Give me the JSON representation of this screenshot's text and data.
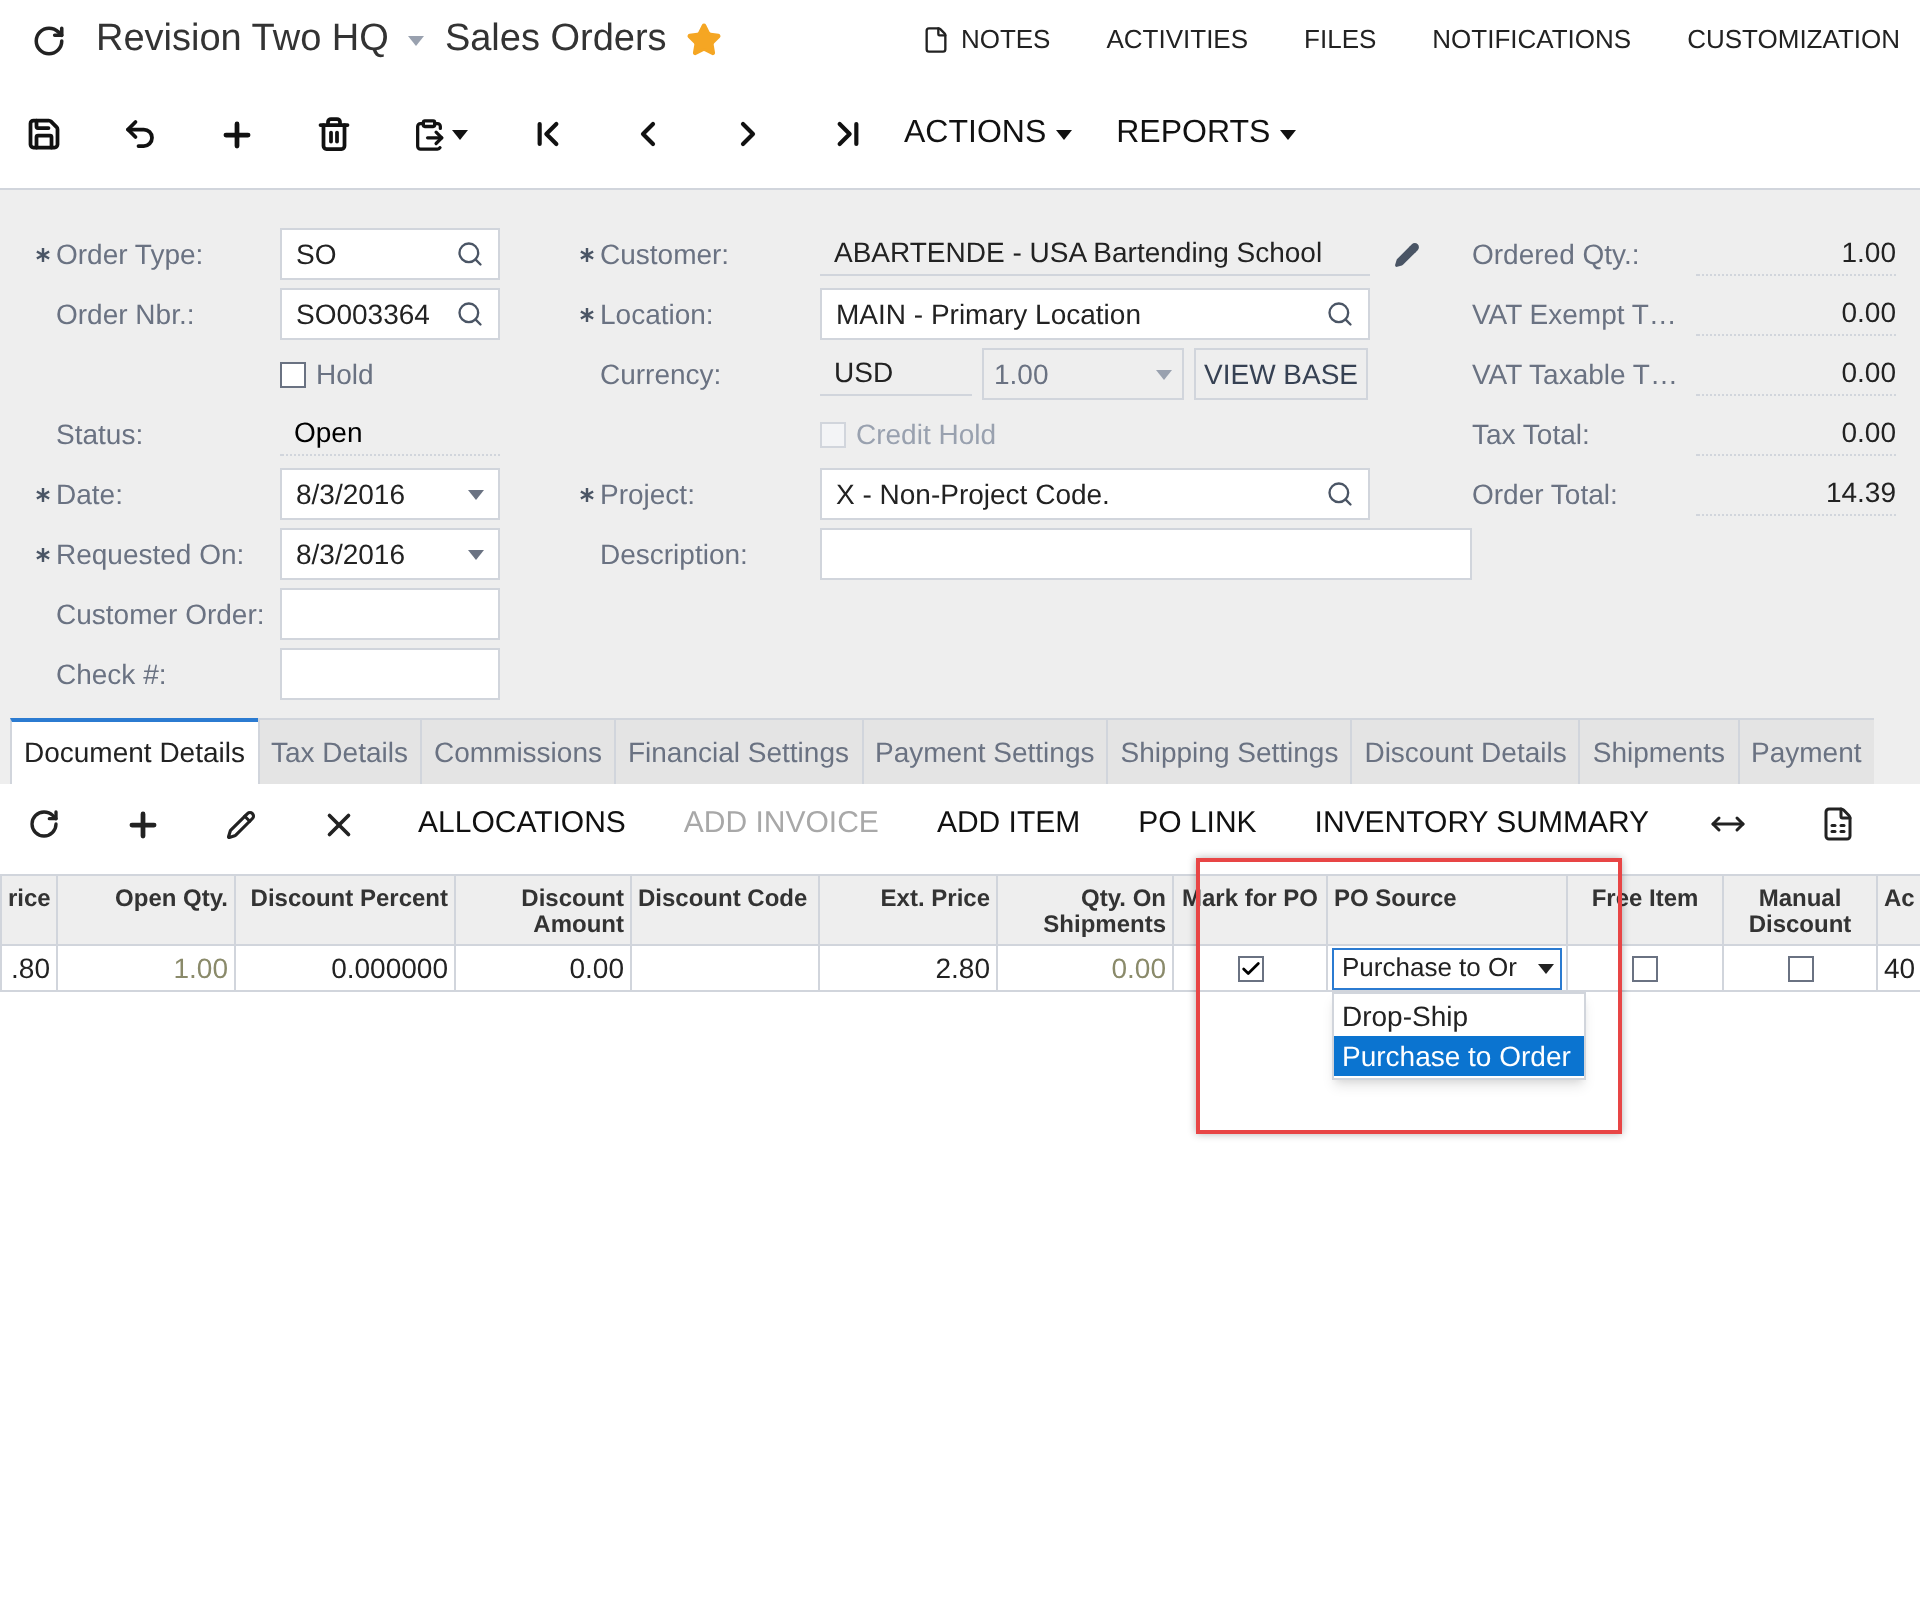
{
  "header": {
    "company": "Revision Two HQ",
    "title": "Sales Orders",
    "favorite": true,
    "links": [
      {
        "label": "NOTES",
        "kind": "note"
      },
      {
        "label": "ACTIVITIES",
        "kind": "plain"
      },
      {
        "label": "FILES",
        "kind": "plain"
      },
      {
        "label": "NOTIFICATIONS",
        "kind": "plain"
      },
      {
        "label": "CUSTOMIZATION",
        "kind": "plain"
      }
    ]
  },
  "toolbar": {
    "menus": [
      "ACTIONS",
      "REPORTS"
    ]
  },
  "form": {
    "left": [
      {
        "kind": "lookup",
        "label": "Order Type:",
        "required": true,
        "value": "SO"
      },
      {
        "kind": "lookup",
        "label": "Order Nbr.:",
        "required": false,
        "value": "SO003364"
      },
      {
        "kind": "checkbox",
        "label": "Hold",
        "checked": false,
        "disabled": false
      },
      {
        "kind": "display",
        "label": "Status:",
        "required": false,
        "value": "Open"
      },
      {
        "kind": "select",
        "label": "Date:",
        "required": true,
        "value": "8/3/2016"
      },
      {
        "kind": "select",
        "label": "Requested On:",
        "required": true,
        "value": "8/3/2016"
      },
      {
        "kind": "text",
        "label": "Customer Order:",
        "required": false
      },
      {
        "kind": "text",
        "label": "Check #:",
        "required": false
      }
    ],
    "middle": [
      {
        "kind": "display_edit",
        "label": "Customer:",
        "required": true,
        "value": "ABARTENDE - USA Bartending School"
      },
      {
        "kind": "lookup",
        "label": "Location:",
        "required": true,
        "value": "MAIN - Primary Location"
      },
      {
        "kind": "currency",
        "label": "Currency:",
        "required": false,
        "value": "USD",
        "rate": "1.00",
        "button": "VIEW BASE"
      },
      {
        "kind": "checkbox",
        "label": "Credit Hold",
        "checked": false,
        "disabled": true
      },
      {
        "kind": "lookup",
        "label": "Project:",
        "required": true,
        "value": "X - Non-Project Code."
      },
      {
        "kind": "wide_text",
        "label": "Description:",
        "required": false
      }
    ],
    "summary": [
      {
        "label": "Ordered Qty.:",
        "value": "1.00"
      },
      {
        "label": "VAT Exempt T…",
        "value": "0.00"
      },
      {
        "label": "VAT Taxable T…",
        "value": "0.00"
      },
      {
        "label": "Tax Total:",
        "value": "0.00"
      },
      {
        "label": "Order Total:",
        "value": "14.39"
      }
    ]
  },
  "tabs": [
    {
      "label": "Document Details",
      "selected": true
    },
    {
      "label": "Tax Details",
      "selected": false
    },
    {
      "label": "Commissions",
      "selected": false
    },
    {
      "label": "Financial Settings",
      "selected": false
    },
    {
      "label": "Payment Settings",
      "selected": false
    },
    {
      "label": "Shipping Settings",
      "selected": false
    },
    {
      "label": "Discount Details",
      "selected": false
    },
    {
      "label": "Shipments",
      "selected": false
    },
    {
      "label": "Payment",
      "selected": false
    }
  ],
  "grid_toolbar": [
    {
      "label": "ALLOCATIONS",
      "disabled": false
    },
    {
      "label": "ADD INVOICE",
      "disabled": true
    },
    {
      "label": "ADD ITEM",
      "disabled": false
    },
    {
      "label": "PO LINK",
      "disabled": false
    },
    {
      "label": "INVENTORY SUMMARY",
      "disabled": false
    }
  ],
  "grid": {
    "columns": [
      "rice",
      "Open Qty.",
      "Discount Percent",
      "Discount Amount",
      "Discount Code",
      "Ext. Price",
      "Qty. On Shipments",
      "Mark for PO",
      "PO Source",
      "Free Item",
      "Manual Discount",
      "Ac"
    ],
    "rows": [
      {
        "cells": [
          {
            "kind": "number",
            "value": ".80"
          },
          {
            "kind": "muted",
            "value": "1.00"
          },
          {
            "kind": "number",
            "value": "0.000000"
          },
          {
            "kind": "number",
            "value": "0.00"
          },
          {
            "kind": "empty"
          },
          {
            "kind": "number",
            "value": "2.80"
          },
          {
            "kind": "muted",
            "value": "0.00"
          },
          {
            "kind": "checkbox",
            "checked": true
          },
          {
            "kind": "select",
            "value": "Purchase to Or",
            "options": [
              {
                "label": "Drop-Ship",
                "selected": false
              },
              {
                "label": "Purchase to Order",
                "selected": true
              }
            ]
          },
          {
            "kind": "checkbox",
            "checked": false
          },
          {
            "kind": "checkbox",
            "checked": false
          },
          {
            "kind": "number",
            "value": "40"
          }
        ]
      }
    ]
  }
}
